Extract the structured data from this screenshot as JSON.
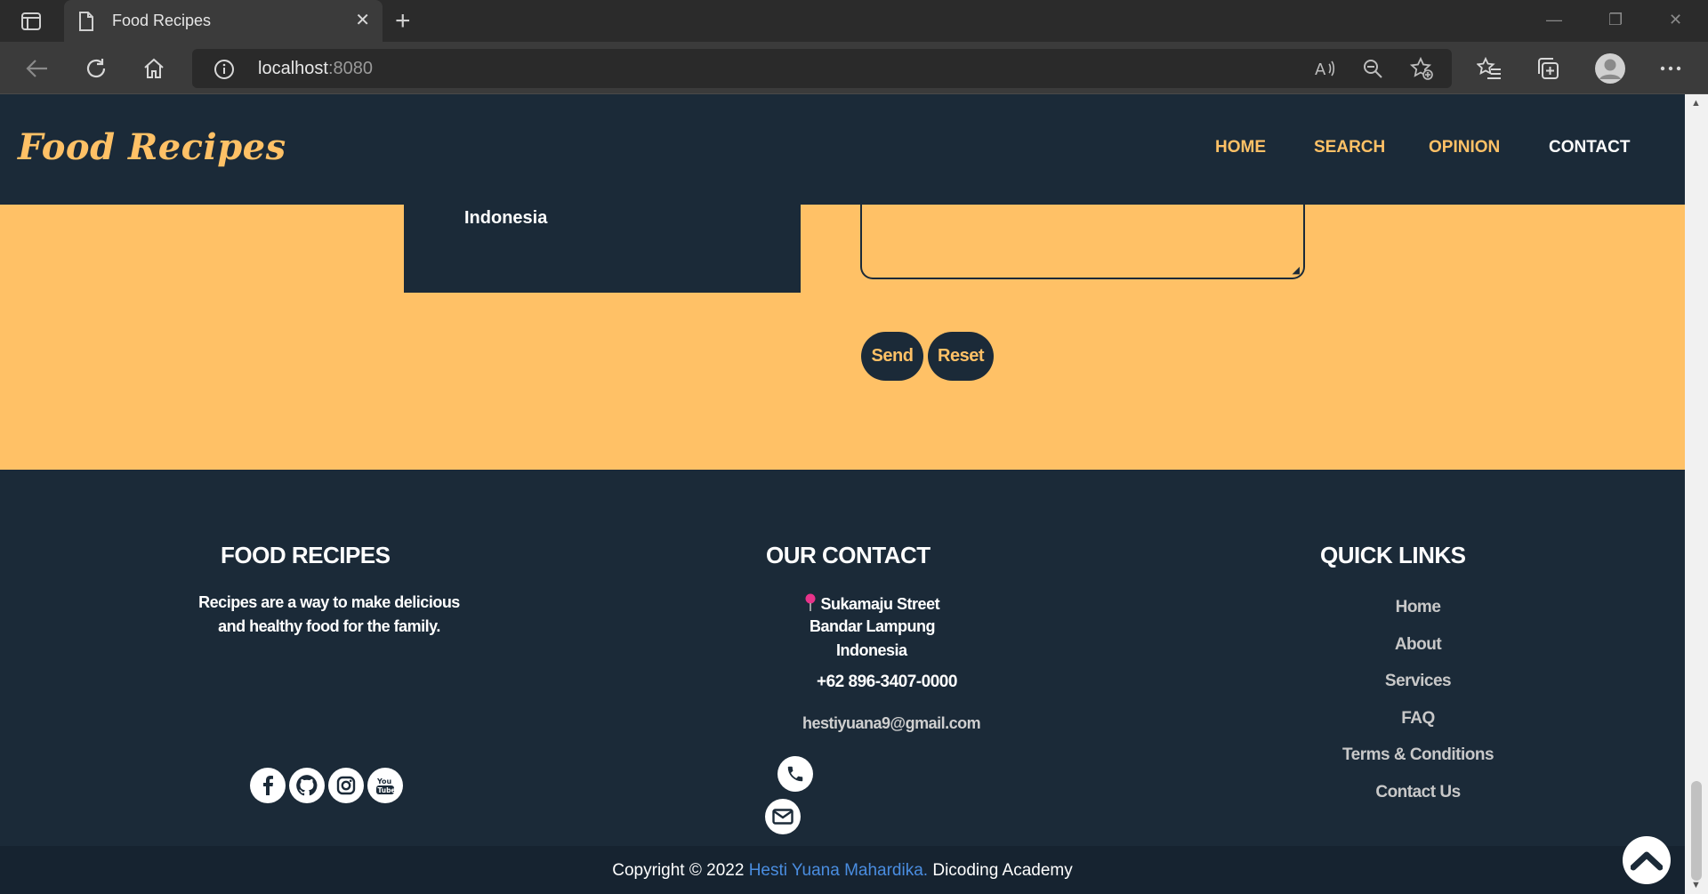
{
  "browser": {
    "tab_title": "Food Recipes",
    "url_host": "localhost",
    "url_port": ":8080"
  },
  "site": {
    "logo": "Food Recipes",
    "nav": [
      {
        "label": "HOME",
        "active": false
      },
      {
        "label": "SEARCH",
        "active": false
      },
      {
        "label": "OPINION",
        "active": false
      },
      {
        "label": "CONTACT",
        "active": true
      }
    ]
  },
  "contact_form": {
    "address_last_line": "Indonesia",
    "send_label": "Send",
    "reset_label": "Reset"
  },
  "footer": {
    "about": {
      "heading": "FOOD RECIPES",
      "description": "Recipes are a way to make delicious and healthy food for the family.",
      "social": [
        "facebook",
        "github",
        "instagram",
        "youtube"
      ]
    },
    "contact": {
      "heading": "OUR CONTACT",
      "street": "Sukamaju Street",
      "city": "Bandar Lampung",
      "country": "Indonesia",
      "phone": "+62 896-3407-0000",
      "email": "hestiyuana9@gmail.com"
    },
    "links": {
      "heading": "QUICK LINKS",
      "items": [
        "Home",
        "About",
        "Services",
        "FAQ",
        "Terms & Conditions",
        "Contact Us"
      ]
    },
    "copyright": {
      "prefix": "Copyright © 2022 ",
      "author": "Hesti Yuana Mahardika.",
      "suffix": " Dicoding Academy"
    }
  },
  "colors": {
    "navy": "#1b2a38",
    "accent": "#ffc166",
    "link_blue": "#4a8de0"
  }
}
